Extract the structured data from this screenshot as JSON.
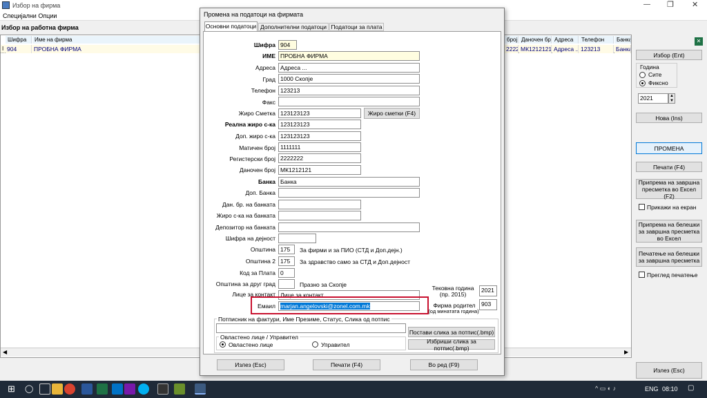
{
  "window": {
    "title": "Избор на фирма",
    "menu": "Специјални Опции",
    "section_title": "Избор на работна фирма"
  },
  "grid": {
    "left_headers": [
      "Шифра",
      "Име на фирма"
    ],
    "right_headers": [
      "број",
      "Даночен бр",
      "Адреса",
      "Телефон",
      "Банка"
    ],
    "row_marker": "I",
    "left_cells": [
      "904",
      "ПРОБНА ФИРМА"
    ],
    "right_cells": [
      "2222",
      "МК1212121",
      "Адреса ...",
      "123213",
      "Банка"
    ]
  },
  "side": {
    "select_btn": "Избор (Ent)",
    "year_label": "Година",
    "radio_all": "Сите",
    "radio_fixed": "Фиксно",
    "year_value": "2021",
    "new_btn": "Нова (Ins)",
    "change_btn": "ПРОМЕНА",
    "print_btn": "Печати (F4)",
    "excel_btn": "Припрема на завршна пресметка во Ексел (F2)",
    "show_screen": "Прикажи на екран",
    "notes_excel_btn": "Припрема на белешки за завршна пресметка во Ексел",
    "print_notes_btn": "Печатење на белешки за завршна пресметка",
    "print_preview": "Преглед печатење",
    "exit_btn": "Излез (Esc)"
  },
  "dialog": {
    "title": "Промена на податоци на фирмата",
    "tabs": [
      "Основни податоци",
      "Дополнителни податоци",
      "Податоци за плата"
    ],
    "labels": {
      "sifra": "Шифра",
      "ime": "ИМЕ",
      "adresa": "Адреса",
      "grad": "Град",
      "telefon": "Телефон",
      "faks": "Факс",
      "ziro": "Жиро Сметка",
      "realna": "Реална жиро с-ка",
      "dop_ziro": "Доп. жиро с-ка",
      "maticen": "Матичен број",
      "registerski": "Регистерски број",
      "danocen": "Даночен број",
      "banka": "Банка",
      "dop_banka": "Доп. Банка",
      "dan_banka": "Дан. бр. на банката",
      "ziro_banka": "Жиро с-ка на банката",
      "depozitor": "Депозитор на банката",
      "sifra_dejnost": "Шифра на дејност",
      "opstina": "Општина",
      "opstina2": "Општина 2",
      "kod_plata": "Код за Плата",
      "opstina_drug": "Општина за друг град",
      "lice": "Лице за контакт",
      "email": "Емаил",
      "tekovna": "Тековна година",
      "tekovna_sub": "(пр. 2015)",
      "roditel": "Фирма родител",
      "roditel_sub": "(од минатата година)"
    },
    "values": {
      "sifra": "904",
      "ime": "ПРОБНА ФИРМА",
      "adresa": "Адреса ...",
      "grad": "1000 Скопје",
      "telefon": "123213",
      "faks": "",
      "ziro": "123123123",
      "realna": "123123123",
      "dop_ziro": "123123123",
      "maticen": "1111111",
      "registerski": "2222222",
      "danocen": "МК1212121",
      "banka": "Банка",
      "dop_banka": "",
      "dan_banka": "",
      "ziro_banka": "",
      "depozitor": "",
      "sifra_dejnost": "",
      "opstina": "175",
      "opstina2": "175",
      "kod_plata": "0",
      "opstina_drug": "",
      "lice": "Лице за контакт",
      "email": "marjan.angelovski@zonel.com.mk",
      "tekovna": "2021",
      "roditel": "903"
    },
    "notes": {
      "opstina": "За фирми и за ПИО (СТД и Доп.дејн.)",
      "opstina2": "За здравство само за СТД и Доп.дејност",
      "opstina_drug": "Празно за Скопје"
    },
    "ziro_btn": "Жиро сметки (F4)",
    "sign_group": "Потписник на фактури, Име Презиме, Статус, Слика од потпис",
    "set_sign_btn": "Постави слика за потпис(.bmp)",
    "del_sign_btn": "Избриши слика за потпис(.bmp)",
    "auth_group": "Овластено лице / Управител",
    "radio_auth": "Овластено лице",
    "radio_mgr": "Управител",
    "exit_btn": "Излез (Esc)",
    "print_btn": "Печати (F4)",
    "ok_btn": "Во ред (F9)"
  },
  "taskbar": {
    "lang": "ENG",
    "time": "08:10"
  }
}
